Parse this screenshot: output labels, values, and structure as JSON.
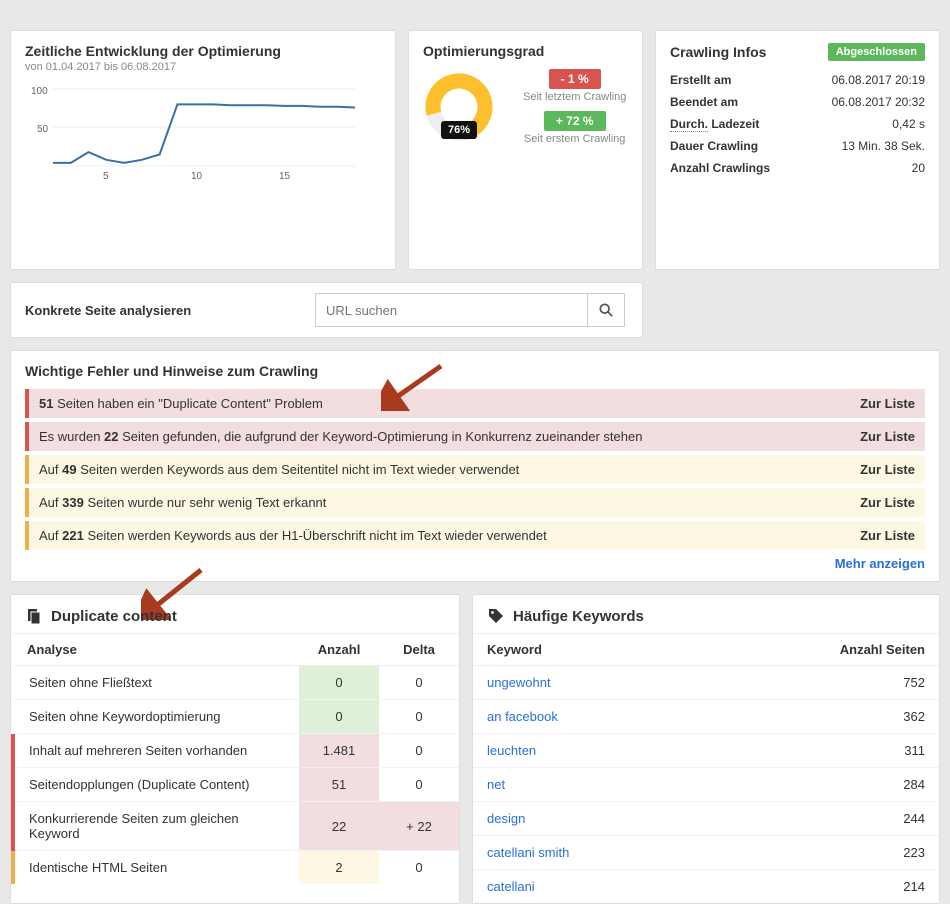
{
  "timeline": {
    "title": "Zeitliche Entwicklung der Optimierung",
    "subtitle": "von 01.04.2017 bis 06.08.2017"
  },
  "optim": {
    "title": "Optimierungsgrad",
    "percent": "76%",
    "diff_last": "- 1 %",
    "since_last": "Seit letztem Crawling",
    "diff_first": "+ 72 %",
    "since_first": "Seit erstem Crawling"
  },
  "info": {
    "title": "Crawling Infos",
    "status": "Abgeschlossen",
    "rows": [
      {
        "label": "Erstellt am",
        "value": "06.08.2017 20:19"
      },
      {
        "label": "Beendet am",
        "value": "06.08.2017 20:32"
      },
      {
        "label": "Durch. Ladezeit",
        "value": "0,42 s",
        "dotted": true
      },
      {
        "label": "Dauer Crawling",
        "value": "13 Min. 38 Sek."
      },
      {
        "label": "Anzahl Crawlings",
        "value": "20"
      }
    ]
  },
  "search": {
    "title": "Konkrete Seite analysieren",
    "placeholder": "URL suchen"
  },
  "errors": {
    "title": "Wichtige Fehler und Hinweise zum Crawling",
    "link_label": "Zur Liste",
    "more": "Mehr anzeigen",
    "items": [
      {
        "severity": "red",
        "html": "<b>51</b> Seiten haben ein \"Duplicate Content\" Problem"
      },
      {
        "severity": "red",
        "html": "Es wurden <b>22</b> Seiten gefunden, die aufgrund der Keyword-Optimierung in Konkurrenz zueinander stehen"
      },
      {
        "severity": "yel",
        "html": "Auf <b>49</b> Seiten werden Keywords aus dem Seitentitel nicht im Text wieder verwendet"
      },
      {
        "severity": "yel",
        "html": "Auf <b>339</b> Seiten wurde nur sehr wenig Text erkannt"
      },
      {
        "severity": "yel",
        "html": "Auf <b>221</b> Seiten werden Keywords aus der H1-Überschrift nicht im Text wieder verwendet"
      }
    ]
  },
  "dup": {
    "title": "Duplicate content",
    "cols": {
      "analysis": "Analyse",
      "count": "Anzahl",
      "delta": "Delta"
    },
    "rows": [
      {
        "label": "Seiten ohne Fließtext",
        "count": "0",
        "delta": "0",
        "sev": "",
        "c1": "green",
        "c2": ""
      },
      {
        "label": "Seiten ohne Keywordoptimierung",
        "count": "0",
        "delta": "0",
        "sev": "",
        "c1": "green",
        "c2": ""
      },
      {
        "label": "Inhalt auf mehreren Seiten vorhanden",
        "count": "1.481",
        "delta": "0",
        "sev": "red",
        "c1": "pink",
        "c2": ""
      },
      {
        "label": "Seitendopplungen (Duplicate Content)",
        "count": "51",
        "delta": "0",
        "sev": "red",
        "c1": "pink",
        "c2": ""
      },
      {
        "label": "Konkurrierende Seiten zum gleichen Keyword",
        "count": "22",
        "delta": "+ 22",
        "sev": "red",
        "c1": "pink",
        "c2": "pink"
      },
      {
        "label": "Identische HTML Seiten",
        "count": "2",
        "delta": "0",
        "sev": "yel",
        "c1": "yel",
        "c2": ""
      }
    ]
  },
  "kw": {
    "title": "Häufige Keywords",
    "cols": {
      "keyword": "Keyword",
      "count": "Anzahl Seiten"
    },
    "rows": [
      {
        "k": "ungewohnt",
        "n": "752"
      },
      {
        "k": "an facebook",
        "n": "362"
      },
      {
        "k": "leuchten",
        "n": "311"
      },
      {
        "k": "net",
        "n": "284"
      },
      {
        "k": "design",
        "n": "244"
      },
      {
        "k": "catellani smith",
        "n": "223"
      },
      {
        "k": "catellani",
        "n": "214"
      }
    ]
  },
  "chart_data": {
    "type": "line",
    "title": "Zeitliche Entwicklung der Optimierung",
    "x": [
      1,
      2,
      3,
      4,
      5,
      6,
      7,
      8,
      9,
      10,
      11,
      12,
      13,
      14,
      15,
      16,
      17,
      18
    ],
    "values": [
      4,
      4,
      18,
      8,
      4,
      8,
      15,
      80,
      80,
      80,
      79,
      79,
      79,
      78,
      78,
      77,
      77,
      76
    ],
    "ylim": [
      0,
      100
    ],
    "yticks": [
      50,
      100
    ],
    "xticks": [
      5,
      10,
      15
    ]
  }
}
